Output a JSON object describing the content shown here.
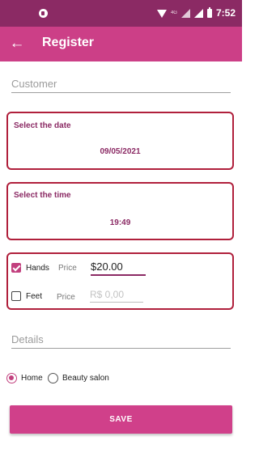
{
  "status_bar": {
    "time": "7:52",
    "network_label": "4G",
    "icons": [
      "app-notification-icon",
      "wifi-icon",
      "signal-icon",
      "signal-icon",
      "battery-icon"
    ]
  },
  "app_bar": {
    "title": "Register",
    "back_icon": "arrow-left-icon",
    "color": "#cc3f87"
  },
  "customer": {
    "placeholder": "Customer",
    "value": ""
  },
  "date_card": {
    "label": "Select the date",
    "value": "09/05/2021"
  },
  "time_card": {
    "label": "Select the time",
    "value": "19:49"
  },
  "services": [
    {
      "name": "Hands",
      "checked": true,
      "price_label": "Price",
      "price_value": "$20.00",
      "price_placeholder": ""
    },
    {
      "name": "Feet",
      "checked": false,
      "price_label": "Price",
      "price_value": "",
      "price_placeholder": "R$ 0,00"
    }
  ],
  "details": {
    "placeholder": "Details",
    "value": ""
  },
  "location": {
    "options": [
      "Home",
      "Beauty salon"
    ],
    "selected": "Home"
  },
  "save_button": {
    "label": "SAVE"
  },
  "colors": {
    "status_bar": "#8b2a64",
    "accent": "#cc3f87",
    "card_border": "#b0203c",
    "card_text": "#8b2a64"
  }
}
